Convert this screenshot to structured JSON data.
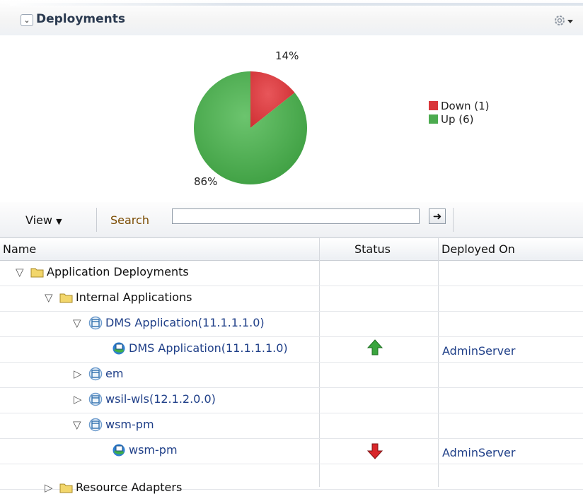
{
  "header": {
    "title": "Deployments",
    "collapse_icon": "chevron-down-icon",
    "menu_icon": "gear-icon"
  },
  "chart_data": {
    "type": "pie",
    "slices": [
      {
        "name": "Down",
        "count": 1,
        "percent": 14,
        "color": "#d9363a"
      },
      {
        "name": "Up",
        "count": 6,
        "percent": 86,
        "color": "#4cab4f"
      }
    ],
    "labels": [
      "14%",
      "86%"
    ],
    "legend": [
      "Down (1)",
      "Up (6)"
    ],
    "legend_placement": "right"
  },
  "toolbar": {
    "view_label": "View",
    "search_label": "Search",
    "search_value": "",
    "go_icon": "arrow-right-icon"
  },
  "table": {
    "columns": [
      "Name",
      "Status",
      "Deployed On"
    ],
    "rows": [
      {
        "name": "Application Deployments",
        "kind": "folder",
        "expanded": true,
        "status": "",
        "deployed_on": ""
      },
      {
        "name": "Internal Applications",
        "kind": "folder",
        "expanded": true,
        "status": "",
        "deployed_on": ""
      },
      {
        "name": "DMS Application(11.1.1.1.0)",
        "kind": "app",
        "expanded": true,
        "status": "",
        "deployed_on": ""
      },
      {
        "name": "DMS Application(11.1.1.1.0)",
        "kind": "instance",
        "status": "up",
        "deployed_on": "AdminServer"
      },
      {
        "name": "em",
        "kind": "app",
        "expanded": false,
        "status": "",
        "deployed_on": ""
      },
      {
        "name": "wsil-wls(12.1.2.0.0)",
        "kind": "app",
        "expanded": false,
        "status": "",
        "deployed_on": ""
      },
      {
        "name": "wsm-pm",
        "kind": "app",
        "expanded": true,
        "status": "",
        "deployed_on": ""
      },
      {
        "name": "wsm-pm",
        "kind": "instance",
        "status": "down",
        "deployed_on": "AdminServer"
      },
      {
        "name": "Resource Adapters",
        "kind": "folder",
        "expanded": false,
        "status": "",
        "deployed_on": ""
      }
    ]
  },
  "colors": {
    "up": "#3aa53e",
    "down": "#d9262a",
    "link": "#1f3f88",
    "folder": "#f2d66b"
  }
}
